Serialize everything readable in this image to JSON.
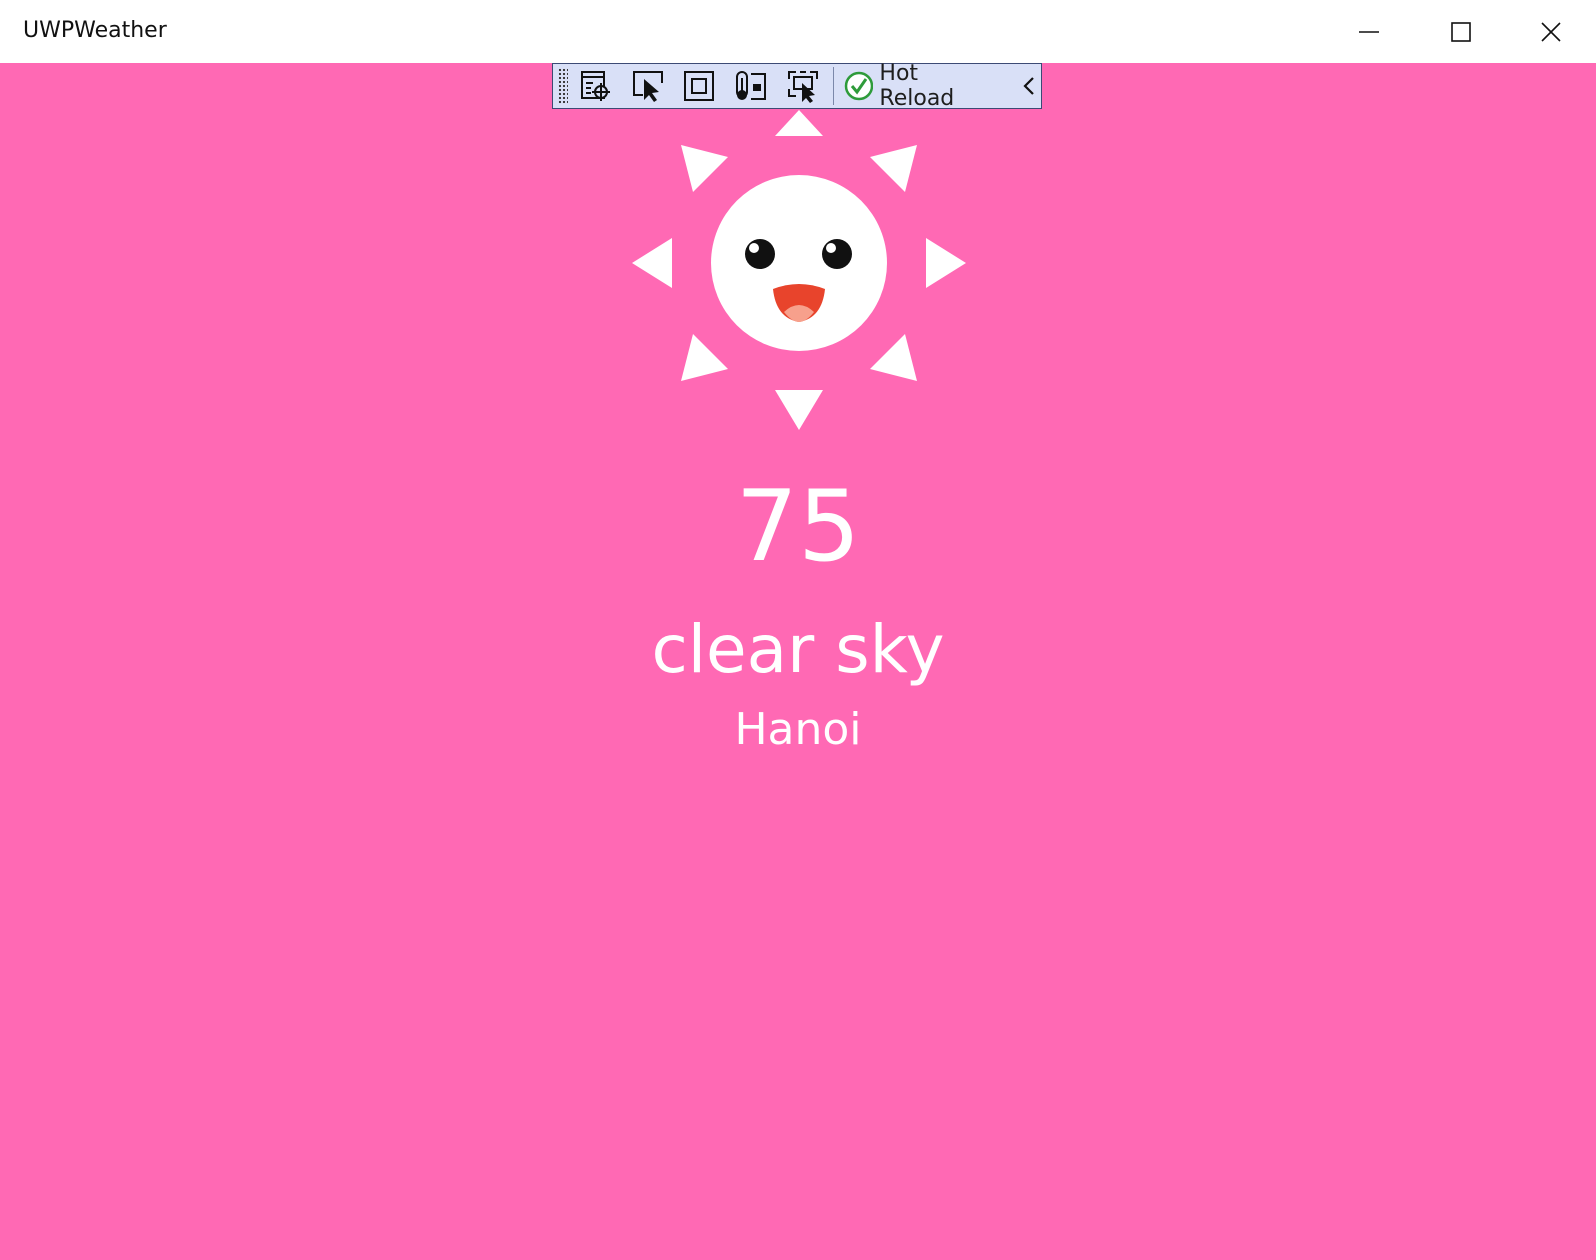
{
  "window": {
    "title": "UWPWeather",
    "controls": {
      "minimize": "minimize-icon",
      "maximize": "maximize-icon",
      "close": "close-icon"
    }
  },
  "colors": {
    "background": "#ff69b4",
    "sun": "#ffffff",
    "mouth": "#e8442c",
    "tongue": "#f7a08c",
    "eye": "#111111",
    "toolbar_bg": "#d9e0f7",
    "check_green": "#2e9b3a"
  },
  "debug_toolbar": {
    "tools": [
      "live-visual-tree-icon",
      "select-element-icon",
      "display-layout-adorners-icon",
      "track-focused-element-icon",
      "preview-selection-icon"
    ],
    "hot_reload": {
      "status_icon": "checkmark-icon",
      "label": "Hot Reload"
    },
    "collapse_icon": "chevron-left-icon"
  },
  "weather": {
    "icon": "smiling-sun-icon",
    "temperature": "75",
    "description": "clear sky",
    "city": "Hanoi"
  }
}
